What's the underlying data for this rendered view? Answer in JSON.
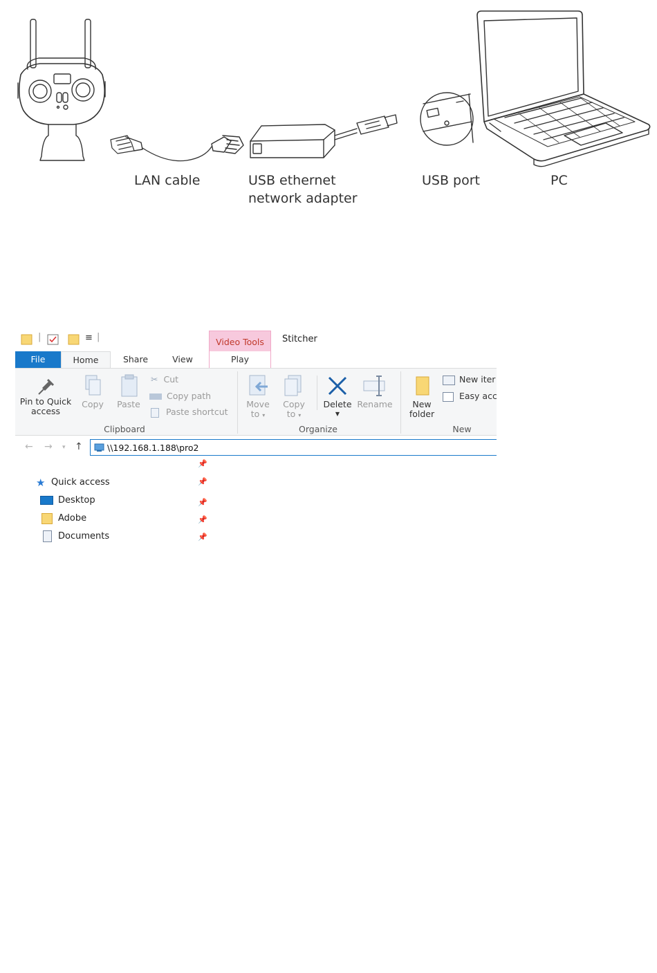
{
  "diagram": {
    "captions": {
      "lan_cable": "LAN cable",
      "adapter_line1": "USB ethernet",
      "adapter_line2": "network adapter",
      "usb_port": "USB port",
      "pc": "PC"
    }
  },
  "explorer": {
    "quick_access_toolbar": {
      "customize_icon": "≡"
    },
    "contextual_tab": "Video Tools",
    "window_title": "Stitcher",
    "tabs": [
      "File",
      "Home",
      "Share",
      "View",
      "Play"
    ],
    "ribbon": {
      "clipboard": {
        "pin_label_1": "Pin to Quick",
        "pin_label_2": "access",
        "copy": "Copy",
        "paste": "Paste",
        "cut": "Cut",
        "copy_path": "Copy path",
        "paste_shortcut": "Paste shortcut",
        "group": "Clipboard"
      },
      "organize": {
        "move_1": "Move",
        "move_2": "to",
        "copy_1": "Copy",
        "copy_2": "to",
        "delete": "Delete",
        "rename": "Rename",
        "group": "Organize"
      },
      "new": {
        "folder_1": "New",
        "folder_2": "folder",
        "new_item": "New iter",
        "easy_access": "Easy acc",
        "group": "New"
      }
    },
    "address": "\\\\192.168.1.188\\pro2",
    "nav": {
      "quick_access": "Quick access",
      "items": [
        "Desktop",
        "Adobe",
        "Documents"
      ]
    }
  }
}
